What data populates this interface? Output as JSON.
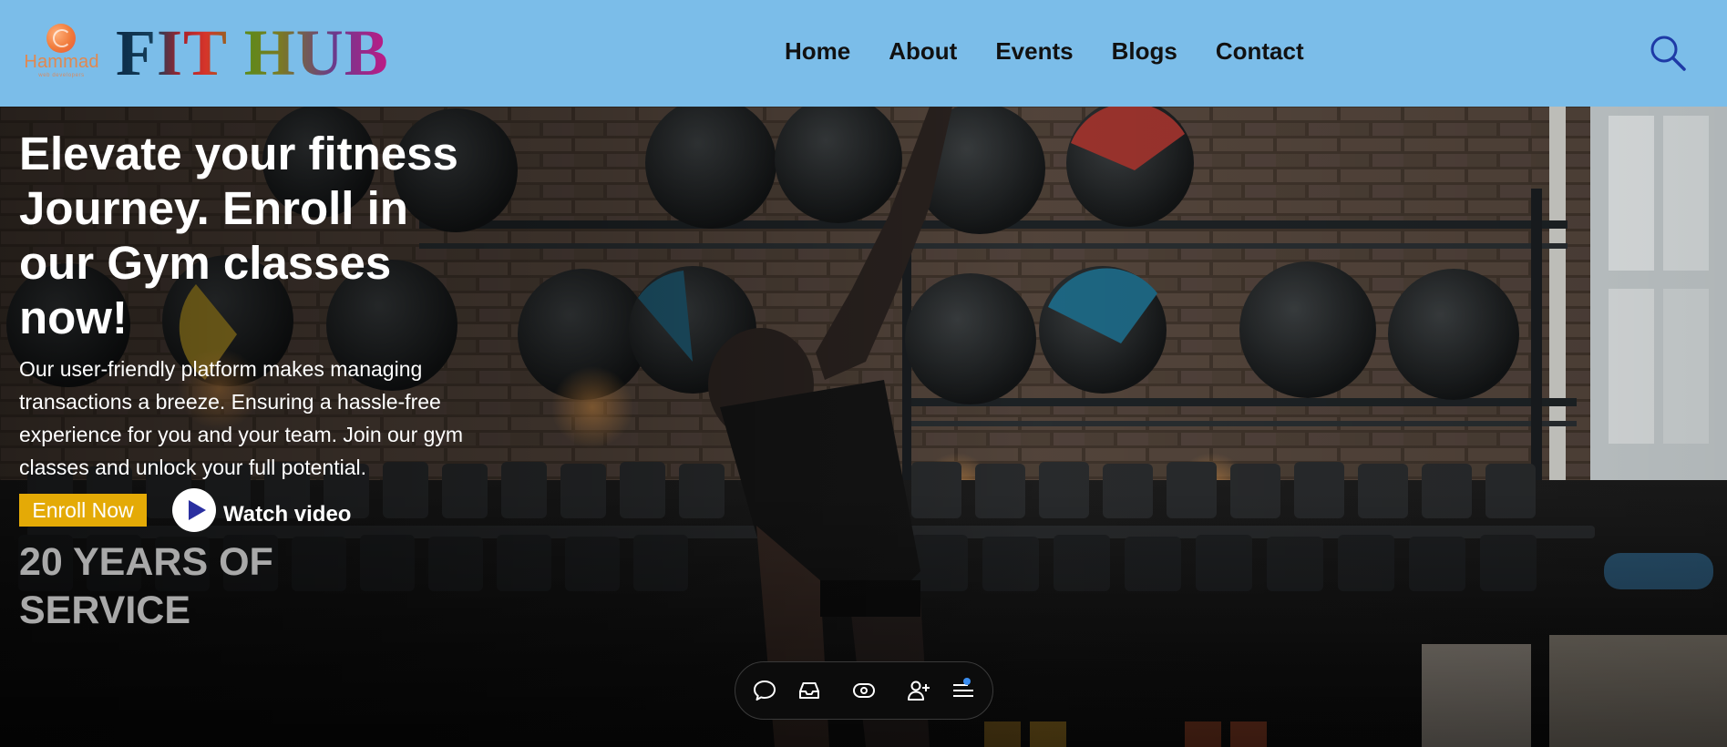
{
  "logo": {
    "name": "Hammad",
    "tagline": "web developers"
  },
  "brand": {
    "title": "FIT HUB"
  },
  "nav": {
    "items": [
      {
        "label": "Home"
      },
      {
        "label": "About"
      },
      {
        "label": "Events"
      },
      {
        "label": "Blogs"
      },
      {
        "label": "Contact"
      }
    ]
  },
  "search": {
    "icon": "search-icon"
  },
  "hero": {
    "title": "Elevate your fitness Journey. Enroll in our Gym classes now!",
    "description": "Our user-friendly platform makes managing transactions a breeze. Ensuring a hassle-free experience for you and your team. Join our gym classes and unlock your full potential.",
    "enroll_label": "Enroll Now",
    "watch_label": "Watch video",
    "years_text": "20 YEARS OF SERVICE",
    "background_icon": "gym-photo"
  },
  "toolbar": {
    "icons": [
      "chat-icon",
      "inbox-icon",
      "eye-icon",
      "add-user-icon",
      "menu-icon"
    ]
  },
  "colors": {
    "header_bg": "#7bbde9",
    "enroll_bg": "#e4aa06",
    "nav_text": "#111111",
    "years_text": "#a9a9a9",
    "search_icon": "#1e3aa6"
  }
}
